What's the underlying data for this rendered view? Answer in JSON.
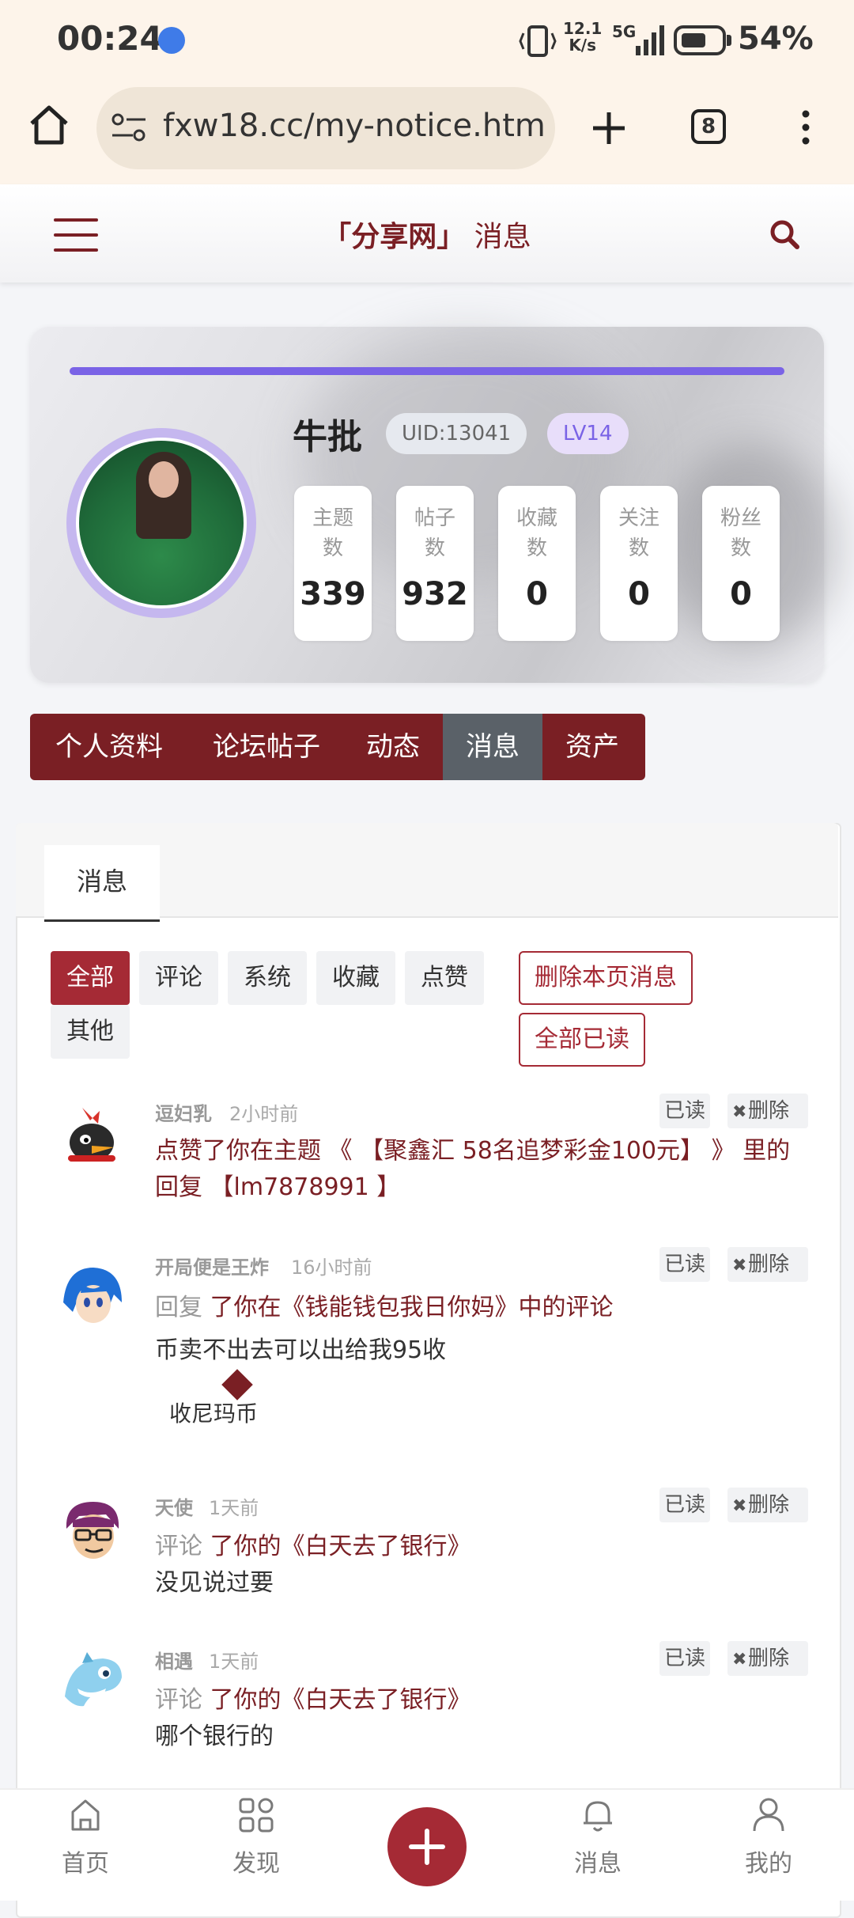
{
  "status_bar": {
    "time": "00:24",
    "net_speed_top": "12.1",
    "net_speed_bottom": "K/s",
    "network": "5G",
    "battery": "54%"
  },
  "browser": {
    "url": "fxw18.cc/my-notice.htm",
    "tab_count": "8"
  },
  "site_header": {
    "brand": "「分享网」",
    "page_title": "消息"
  },
  "profile": {
    "username": "牛批",
    "uid": "UID:13041",
    "level": "LV14",
    "stats": [
      {
        "label": "主题数",
        "value": "339"
      },
      {
        "label": "帖子数",
        "value": "932"
      },
      {
        "label": "收藏数",
        "value": "0"
      },
      {
        "label": "关注数",
        "value": "0"
      },
      {
        "label": "粉丝数",
        "value": "0"
      }
    ]
  },
  "profile_nav": [
    "个人资料",
    "论坛帖子",
    "动态",
    "消息",
    "资产"
  ],
  "panel": {
    "tab": "消息"
  },
  "filters": [
    "全部",
    "评论",
    "系统",
    "收藏",
    "点赞",
    "其他"
  ],
  "actions": {
    "delete_page": "删除本页消息",
    "mark_all_read": "全部已读"
  },
  "message_buttons": {
    "read": "已读",
    "delete": "删除"
  },
  "messages": [
    {
      "user": "逗妇乳",
      "time": "2小时前",
      "line1": "点赞了你在主题 《 【聚鑫汇 58名追梦彩金100元】 》 里的",
      "line2": "回复 【lm7878991 】"
    },
    {
      "user": "开局便是王炸",
      "time": "16小时前",
      "action": "回复",
      "target": "了你在《钱能钱包我日你妈》中的评论",
      "body": "币卖不出去可以出给我95收",
      "quote": "收尼玛币"
    },
    {
      "user": "天使",
      "time": "1天前",
      "action": "评论",
      "target": "了你的《白天去了银行》",
      "body": "没见说过要"
    },
    {
      "user": "相遇",
      "time": "1天前",
      "action": "评论",
      "target": "了你的《白天去了银行》",
      "body": "哪个银行的"
    }
  ],
  "bottom_nav": [
    "首页",
    "发现",
    "消息",
    "我的"
  ],
  "colors": {
    "brand": "#7a1f24",
    "accent": "#a52a35",
    "level": "#7a63e6"
  }
}
